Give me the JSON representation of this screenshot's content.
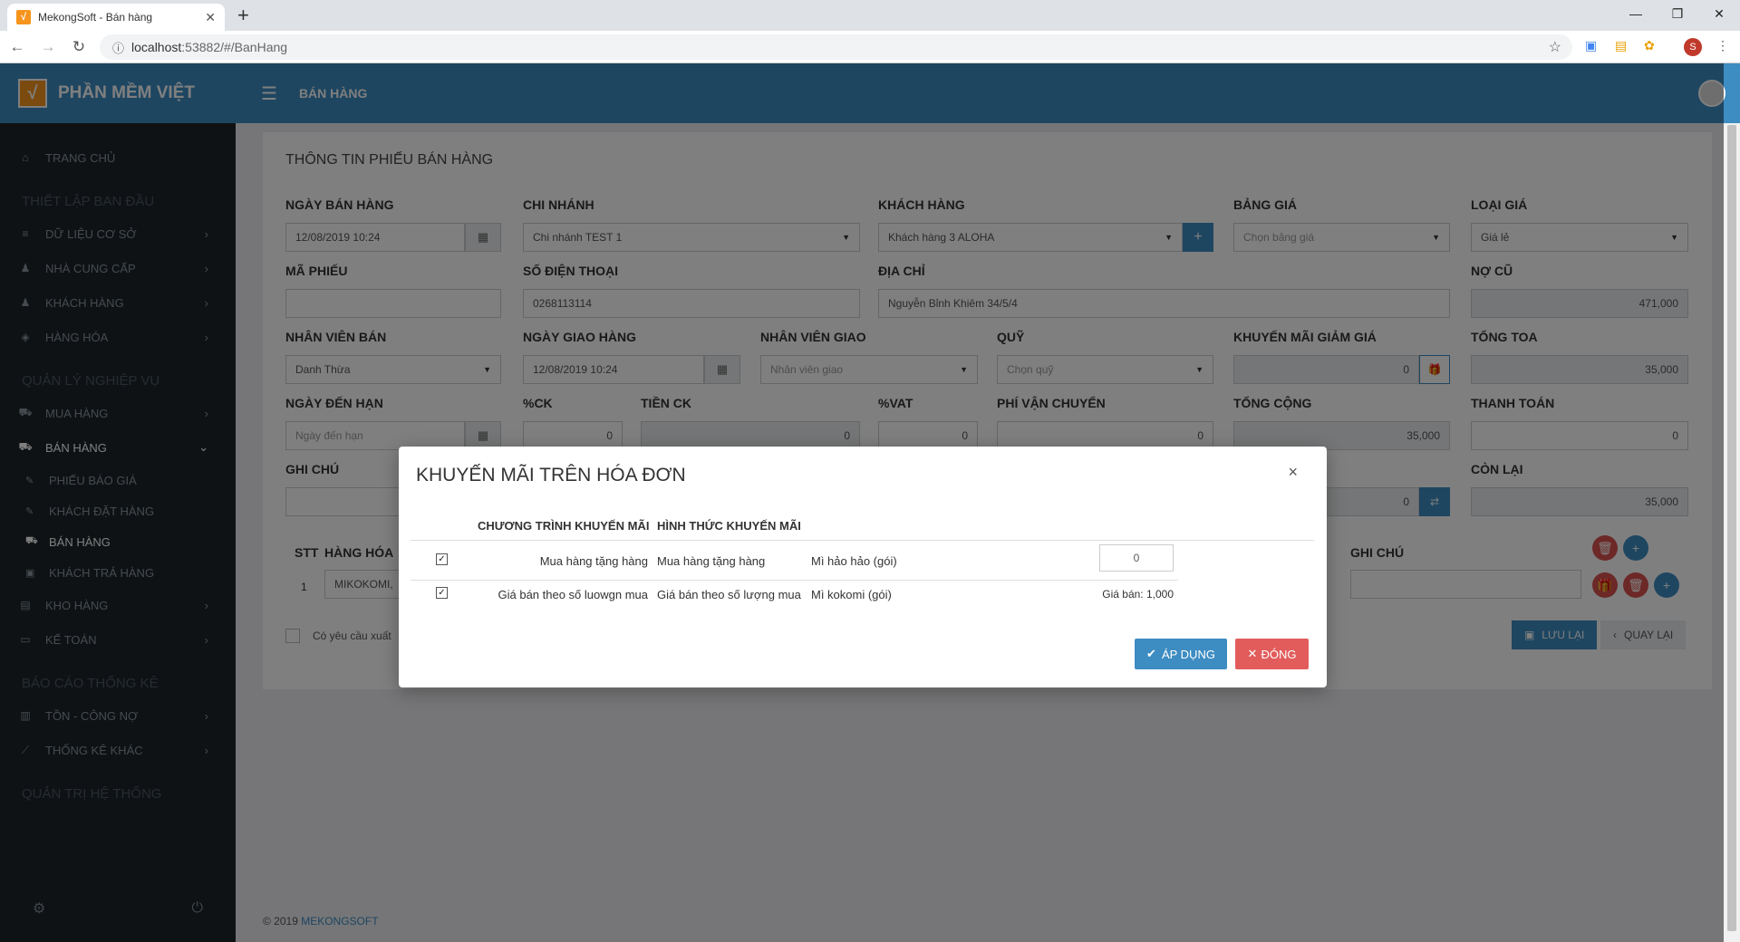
{
  "browser": {
    "tab_title": "MekongSoft - Bán hàng",
    "url_host": "localhost",
    "url_path": ":53882/#/BanHang",
    "profile_initial": "S"
  },
  "sidebar": {
    "brand": "PHẦN MỀM VIỆT",
    "home": "TRANG CHỦ",
    "sec_setup": "THIẾT LẬP BAN ĐẦU",
    "master_data": "DỮ LIỆU CƠ SỞ",
    "supplier": "NHÀ CUNG CẤP",
    "customer": "KHÁCH HÀNG",
    "goods": "HÀNG HÓA",
    "sec_ops": "QUẢN LÝ NGHIỆP VỤ",
    "purchase": "MUA HÀNG",
    "sales": "BÁN HÀNG",
    "sub_quote": "PHIẾU BÁO GIÁ",
    "sub_order": "KHÁCH ĐẶT HÀNG",
    "sub_sales": "BÁN HÀNG",
    "sub_return": "KHÁCH TRẢ HÀNG",
    "warehouse": "KHO HÀNG",
    "accounting": "KẾ TOÁN",
    "sec_reports": "BÁO CÁO THỐNG KÊ",
    "inventory_debt": "TỒN - CÔNG NỢ",
    "other_stats": "THỐNG KÊ KHÁC",
    "sec_admin": "QUẢN TRỊ HỆ THỐNG"
  },
  "topbar": {
    "title": "BÁN HÀNG"
  },
  "form": {
    "title": "THÔNG TIN PHIẾU BÁN HÀNG",
    "lbl_sale_date": "NGÀY BÁN HÀNG",
    "sale_date": "12/08/2019 10:24",
    "lbl_branch": "CHI NHÁNH",
    "branch": "Chi nhánh TEST 1",
    "lbl_customer": "KHÁCH HÀNG",
    "customer": "Khách hàng 3 ALOHA",
    "lbl_pricelist": "BẢNG GIÁ",
    "pricelist_ph": "Chọn bảng giá",
    "lbl_price_type": "LOẠI GIÁ",
    "price_type": "Giá lẻ",
    "lbl_code": "MÃ PHIẾU",
    "lbl_phone": "SỐ ĐIỆN THOẠI",
    "phone": "0268113114",
    "lbl_address": "ĐỊA CHỈ",
    "address": "Nguyễn Bỉnh Khiêm 34/5/4",
    "lbl_old_debt": "NỢ CŨ",
    "old_debt": "471,000",
    "lbl_seller": "NHÂN VIÊN BÁN",
    "seller": "Danh Thừa",
    "lbl_delivery_date": "NGÀY GIAO HÀNG",
    "delivery_date": "12/08/2019 10:24",
    "lbl_deliverer": "NHÂN VIÊN GIAO",
    "deliverer_ph": "Nhân viên giao",
    "lbl_fund": "QUỸ",
    "fund_ph": "Chọn quỹ",
    "lbl_promo_discount": "KHUYẾN MÃI GIẢM GIÁ",
    "promo_discount": "0",
    "lbl_total_invoice": "TỔNG TOA",
    "total_invoice": "35,000",
    "lbl_due_date": "NGÀY ĐẾN HẠN",
    "due_date_ph": "Ngày đến hạn",
    "lbl_ck_pct": "%CK",
    "ck_pct": "0",
    "lbl_ck_amount": "TIỀN CK",
    "ck_amount": "0",
    "lbl_vat": "%VAT",
    "vat": "0",
    "lbl_shipping": "PHÍ VẬN CHUYỂN",
    "shipping": "0",
    "lbl_grand_total": "TỔNG CỘNG",
    "grand_total": "35,000",
    "lbl_payment": "THANH TOÁN",
    "payment": "0",
    "lbl_note": "GHI CHÚ",
    "hidden_field_value": "0",
    "lbl_remaining": "CÒN LẠI",
    "remaining": "35,000",
    "col_stt": "STT",
    "col_goods": "HÀNG HÓA",
    "col_note": "GHI CHÚ",
    "row1_stt": "1",
    "row1_goods": "MIKOKOMI,",
    "export_req": "Có yêu cầu xuất",
    "save": "LƯU LẠI",
    "back": "QUAY LẠI"
  },
  "footer": {
    "copyright": "© 2019",
    "brand": "MEKONGSOFT"
  },
  "modal": {
    "title": "KHUYẾN MÃI TRÊN HÓA ĐƠN",
    "col_program": "CHƯƠNG TRÌNH KHUYẾN MÃI",
    "col_form": "HÌNH THỨC KHUYẾN MÃI",
    "rows": [
      {
        "program": "Mua hàng tặng hàng",
        "form": "Mua hàng tặng hàng",
        "item": "Mì hảo hảo (gói)",
        "value": "0"
      },
      {
        "program": "Giá bán theo số luowgn mua",
        "form": "Giá bán theo số lượng mua",
        "item": "Mì kokomi (gói)",
        "value": "Giá bán: 1,000"
      }
    ],
    "apply": "ÁP DỤNG",
    "close": "ĐÓNG"
  }
}
